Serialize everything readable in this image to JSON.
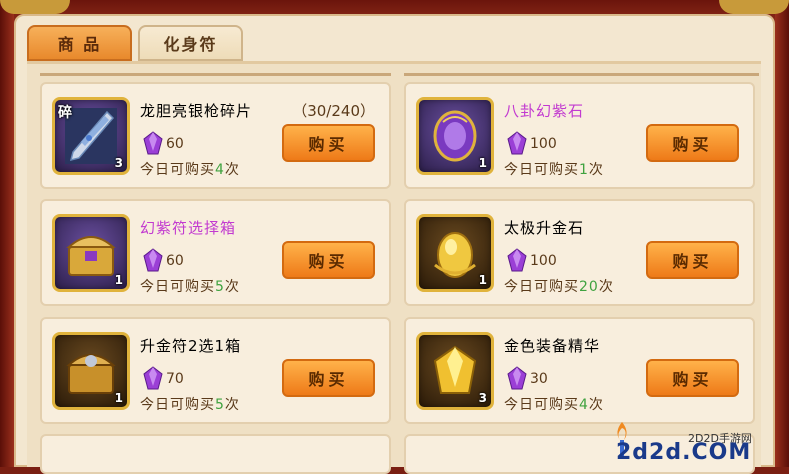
{
  "tabs": [
    {
      "label": "商 品",
      "active": true
    },
    {
      "label": "化身符",
      "active": false
    }
  ],
  "currency_icon": "purple-gem-icon",
  "items": [
    {
      "name": "龙胆亮银枪碎片",
      "name_color": "#5a3a1a",
      "extra": "（30/240）",
      "badge": "碎",
      "count": "3",
      "icon": "silver-spear-icon",
      "price": "60",
      "limit_prefix": "今日可购买",
      "limit_num": "4",
      "limit_suffix": "次",
      "buy_label": "购买"
    },
    {
      "name": "八卦幻紫石",
      "name_color": "#c23ad0",
      "extra": "",
      "badge": "",
      "count": "1",
      "icon": "purple-orb-icon",
      "price": "100",
      "limit_prefix": "今日可购买",
      "limit_num": "1",
      "limit_suffix": "次",
      "buy_label": "购买"
    },
    {
      "name": "幻紫符选择箱",
      "name_color": "#c23ad0",
      "extra": "",
      "badge": "",
      "count": "1",
      "icon": "treasure-chest-icon",
      "price": "60",
      "limit_prefix": "今日可购买",
      "limit_num": "5",
      "limit_suffix": "次",
      "buy_label": "购买"
    },
    {
      "name": "太极升金石",
      "name_color": "#5a3a1a",
      "extra": "",
      "badge": "",
      "count": "1",
      "icon": "gold-egg-icon",
      "price": "100",
      "limit_prefix": "今日可购买",
      "limit_num": "20",
      "limit_suffix": "次",
      "buy_label": "购买"
    },
    {
      "name": "升金符2选1箱",
      "name_color": "#5a3a1a",
      "extra": "",
      "badge": "",
      "count": "1",
      "icon": "gold-chest-icon",
      "price": "70",
      "limit_prefix": "今日可购买",
      "limit_num": "5",
      "limit_suffix": "次",
      "buy_label": "购买"
    },
    {
      "name": "金色装备精华",
      "name_color": "#5a3a1a",
      "extra": "",
      "badge": "",
      "count": "3",
      "icon": "gold-gem-icon",
      "price": "30",
      "limit_prefix": "今日可购买",
      "limit_num": "4",
      "limit_suffix": "次",
      "buy_label": "购买"
    }
  ],
  "watermark": {
    "cn": "2D2D手游网",
    "en": "2d2d.COM"
  }
}
